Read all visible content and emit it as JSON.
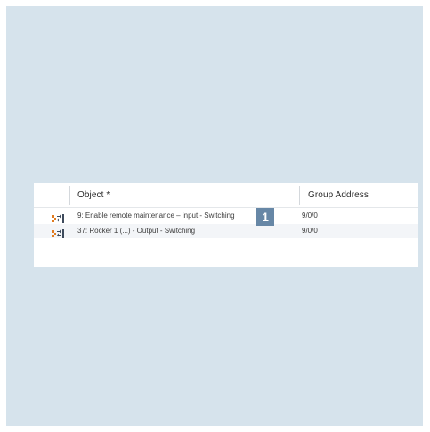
{
  "table": {
    "columns": {
      "object": "Object *",
      "group_address": "Group Address"
    },
    "rows": [
      {
        "icon": "group-object-icon",
        "object": "9: Enable remote maintenance – input - Switching",
        "group_address": "9/0/0"
      },
      {
        "icon": "group-object-icon",
        "object": "37: Rocker 1 (...) - Output - Switching",
        "group_address": "9/0/0"
      }
    ]
  },
  "callout": {
    "label": "1"
  },
  "colors": {
    "background": "#d6e3ec",
    "badge": "#6787a6",
    "icon_orange": "#e07b20",
    "icon_dark": "#3d4a5c"
  }
}
